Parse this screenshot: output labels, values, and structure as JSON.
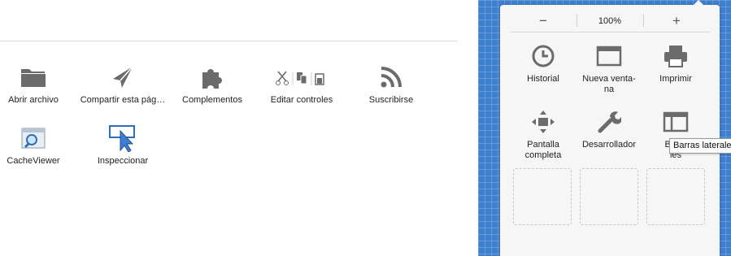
{
  "palette": {
    "items": [
      {
        "label": "Abrir archivo",
        "icon": "folder-icon"
      },
      {
        "label": "Compartir esta pág…",
        "icon": "paper-plane-icon"
      },
      {
        "label": "Complementos",
        "icon": "puzzle-icon"
      },
      {
        "label": "Editar controles",
        "icon": "edit-controls-icon"
      },
      {
        "label": "Suscribirse",
        "icon": "rss-icon"
      },
      {
        "label": "CacheViewer",
        "icon": "cacheviewer-icon"
      },
      {
        "label": "Inspeccionar",
        "icon": "inspect-icon"
      }
    ]
  },
  "menu_panel": {
    "zoom": {
      "minus": "−",
      "level": "100%",
      "plus": "+"
    },
    "items": [
      {
        "label": "Historial",
        "icon": "clock-icon"
      },
      {
        "label": "Nueva venta-\nna",
        "icon": "new-window-icon"
      },
      {
        "label": "Imprimir",
        "icon": "printer-icon"
      },
      {
        "label": "Pantalla\ncompleta",
        "icon": "fullscreen-icon"
      },
      {
        "label": "Desarrollador",
        "icon": "wrench-icon"
      },
      {
        "label": "Barra\nles",
        "icon": "sidebar-icon"
      }
    ]
  },
  "tooltip": {
    "text": "Barras laterales"
  },
  "colors": {
    "background_blue": "#3f7fcf",
    "icon_gray": "#6b6b6b",
    "panel_bg": "#f6f6f6"
  }
}
